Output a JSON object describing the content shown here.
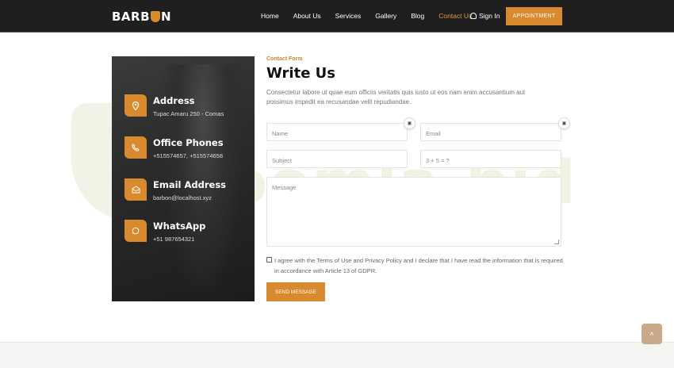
{
  "header": {
    "logo_left": "BARB",
    "logo_right": "N",
    "nav": [
      "Home",
      "About Us",
      "Services",
      "Gallery",
      "Blog",
      "Contact Us"
    ],
    "active_nav": "Contact Us",
    "signin_label": "Sign In",
    "appointment_label": "APPOINTMENT"
  },
  "watermark": {
    "text": "oomla.bid"
  },
  "info": {
    "items": [
      {
        "icon": "location-pin-icon",
        "title": "Address",
        "value": "Tupac Amaru 250 - Comas"
      },
      {
        "icon": "phone-icon",
        "title": "Office Phones",
        "value": "+515574657, +515574658"
      },
      {
        "icon": "mail-icon",
        "title": "Email Address",
        "value": "barbon@localhost.xyz"
      },
      {
        "icon": "whatsapp-icon",
        "title": "WhatsApp",
        "value": "+51 987654321"
      }
    ]
  },
  "form": {
    "label": "Contact Form",
    "title": "Write Us",
    "description": "Consectetur labore ut quae eum officiis veritatis quis iusto ut eos nam enim accusantium aut possimus impedit ea recusandae velit repudiandae.",
    "name_placeholder": "Name",
    "email_placeholder": "Email",
    "subject_placeholder": "Subject",
    "captcha_placeholder": "3 + 5 = ?",
    "message_placeholder": "Message",
    "agree_text": "I agree with the Terms of Use and Privacy Policy and I declare that I have read the information that is required in accordance with Article 13 of GDPR.",
    "submit_label": "SEND MESSAGE"
  },
  "colors": {
    "accent": "#d98a2f",
    "header_bg": "#1f1f1f"
  }
}
